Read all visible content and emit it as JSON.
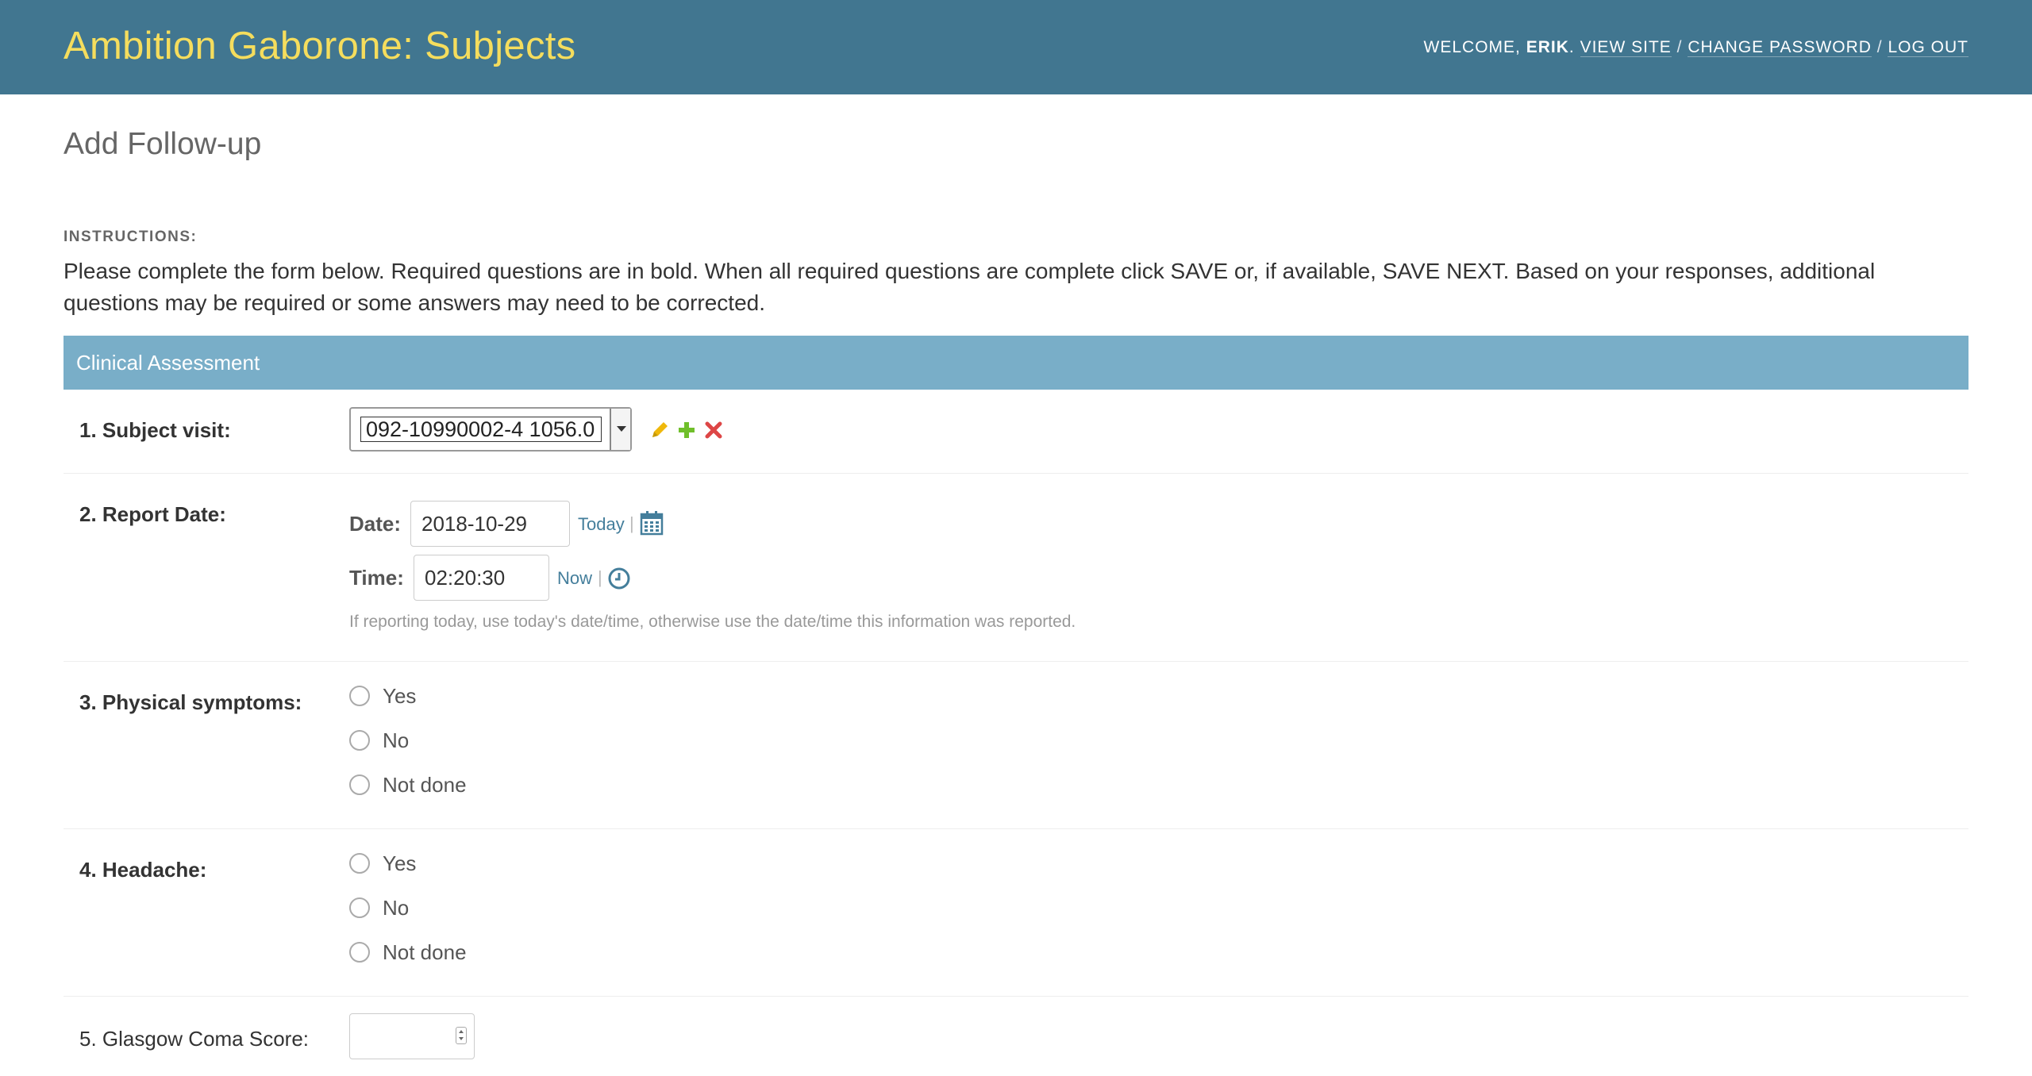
{
  "header": {
    "title": "Ambition Gaborone: Subjects",
    "welcome_prefix": "Welcome, ",
    "user": "Erik",
    "view_site": "View site",
    "change_password": "Change password",
    "log_out": "Log out",
    "separator": "/",
    "background_color": "#417690",
    "title_color": "#f5dd5d"
  },
  "page": {
    "title": "Add Follow-up",
    "instructions_label": "INSTRUCTIONS:",
    "instructions_text": "Please complete the form below. Required questions are in bold. When all required questions are complete click SAVE or, if available, SAVE NEXT. Based on your responses, additional questions may be required or some answers may need to be corrected."
  },
  "fieldset": {
    "title": "Clinical Assessment",
    "header_color": "#79aec8"
  },
  "fields": {
    "subject_visit": {
      "label": "1. Subject visit:",
      "value": "092-10990002-4 1056.0",
      "icons": [
        "pencil-icon",
        "plus-icon",
        "delete-x-icon"
      ]
    },
    "report_date": {
      "label": "2. Report Date:",
      "date_label": "Date:",
      "date_value": "2018-10-29",
      "today_link": "Today",
      "time_label": "Time:",
      "time_value": "02:20:30",
      "now_link": "Now",
      "shortcut_separator": "|",
      "help_text": "If reporting today, use today's date/time, otherwise use the date/time this information was reported."
    },
    "physical_symptoms": {
      "label": "3. Physical symptoms:",
      "options": [
        "Yes",
        "No",
        "Not done"
      ]
    },
    "headache": {
      "label": "4. Headache:",
      "options": [
        "Yes",
        "No",
        "Not done"
      ]
    },
    "glasgow_coma_score": {
      "label": "5. Glasgow Coma Score:",
      "value": ""
    }
  }
}
